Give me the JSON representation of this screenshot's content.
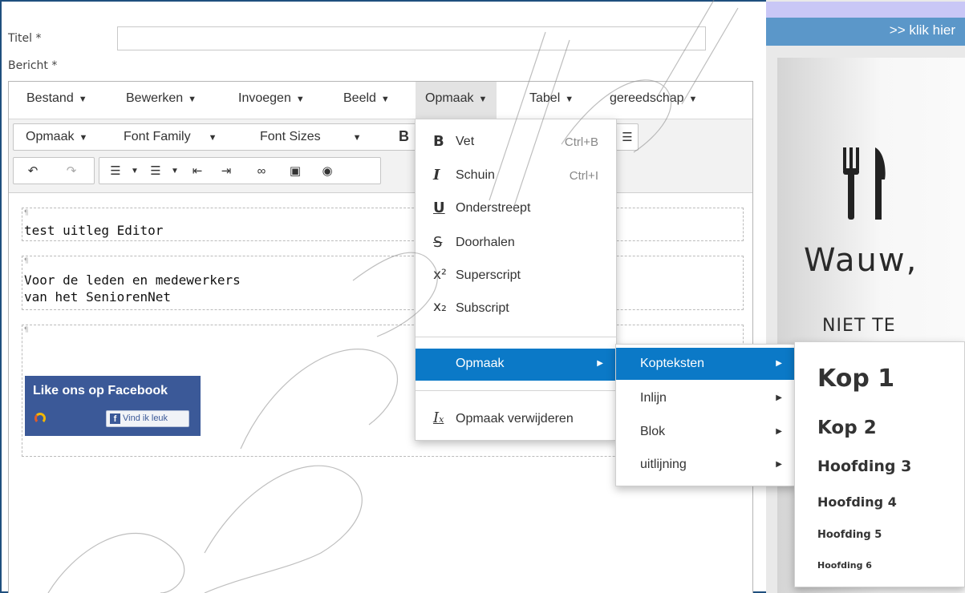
{
  "form": {
    "titel_label": "Titel *",
    "bericht_label": "Bericht *",
    "titel_value": ""
  },
  "menubar": {
    "items": [
      "Bestand",
      "Bewerken",
      "Invoegen",
      "Beeld",
      "Opmaak",
      "Tabel",
      "gereedschap"
    ],
    "active": "Opmaak"
  },
  "toolbar": {
    "opmaak": "Opmaak",
    "font_family": "Font Family",
    "font_sizes": "Font Sizes",
    "bold": "B"
  },
  "content": {
    "p1": "test uitleg Editor",
    "p2_line1": "Voor de leden en medewerkers",
    "p2_line2": "van het SeniorenNet",
    "fb_title": "Like ons op Facebook",
    "fb_button": "Vind ik leuk"
  },
  "opmaak_menu": {
    "items": [
      {
        "icon": "B",
        "label": "Vet",
        "shortcut": "Ctrl+B"
      },
      {
        "icon": "I",
        "label": "Schuin",
        "shortcut": "Ctrl+I"
      },
      {
        "icon": "U",
        "label": "Onderstreept",
        "shortcut": ""
      },
      {
        "icon": "S",
        "label": "Doorhalen",
        "shortcut": ""
      },
      {
        "icon": "x²",
        "label": "Superscript",
        "shortcut": ""
      },
      {
        "icon": "x₂",
        "label": "Subscript",
        "shortcut": ""
      }
    ],
    "submenu": "Opmaak",
    "clear": "Opmaak verwijderen"
  },
  "opmaak_submenu": {
    "items": [
      "Kopteksten",
      "Inlijn",
      "Blok",
      "uitlijning"
    ],
    "highlighted": "Kopteksten"
  },
  "kopteksten_menu": {
    "items": [
      "Kop 1",
      "Kop 2",
      "Hoofding 3",
      "Hoofding 4",
      "Hoofding 5",
      "Hoofding 6"
    ]
  },
  "sidebar": {
    "link": ">> klik hier",
    "ad_headline": "Wauw,",
    "ad_sub": "NIET TE"
  },
  "colors": {
    "highlight": "#0b79c7",
    "frame": "#1f4f7e",
    "facebook": "#3b5998",
    "sidebar_bar": "#5b97c9"
  }
}
